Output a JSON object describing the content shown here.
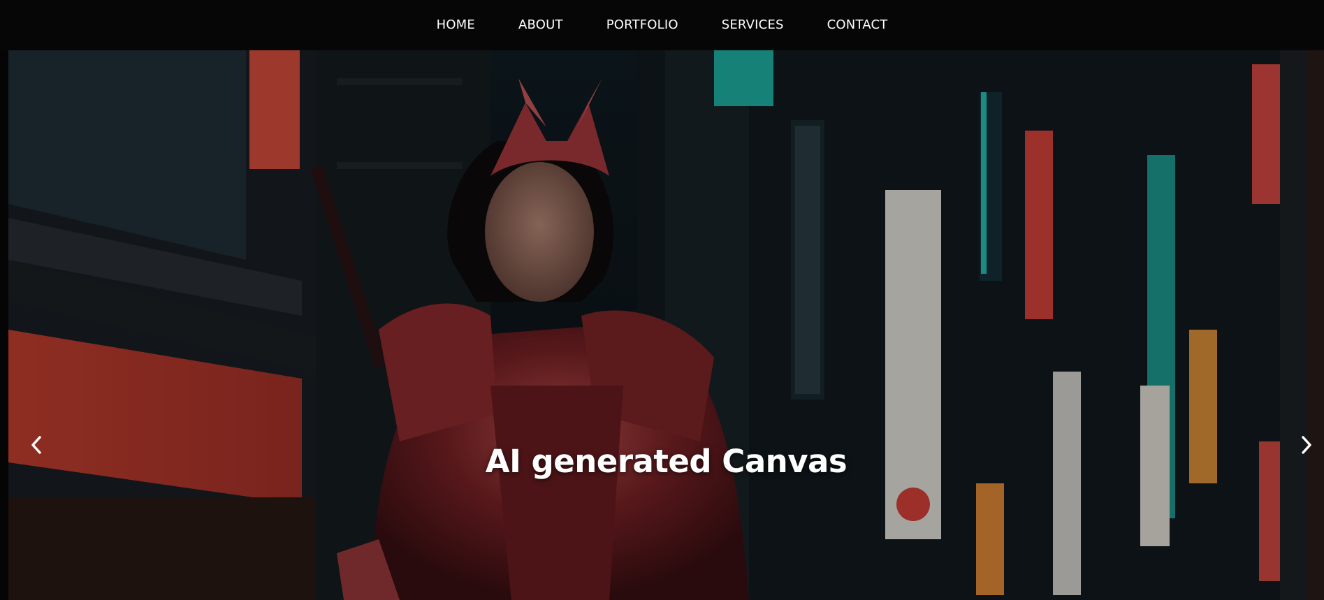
{
  "nav": {
    "items": [
      {
        "label": "HOME"
      },
      {
        "label": "ABOUT"
      },
      {
        "label": "PORTFOLIO"
      },
      {
        "label": "SERVICES"
      },
      {
        "label": "CONTACT"
      }
    ]
  },
  "hero": {
    "title": "AI generated Canvas",
    "prev_icon": "chevron-left-icon",
    "next_icon": "chevron-right-icon"
  },
  "colors": {
    "nav_background": "#060606",
    "text": "#ffffff",
    "neon_red": "#d63a34",
    "neon_teal": "#1fb3a6",
    "armor_red": "#8a2a2c"
  }
}
